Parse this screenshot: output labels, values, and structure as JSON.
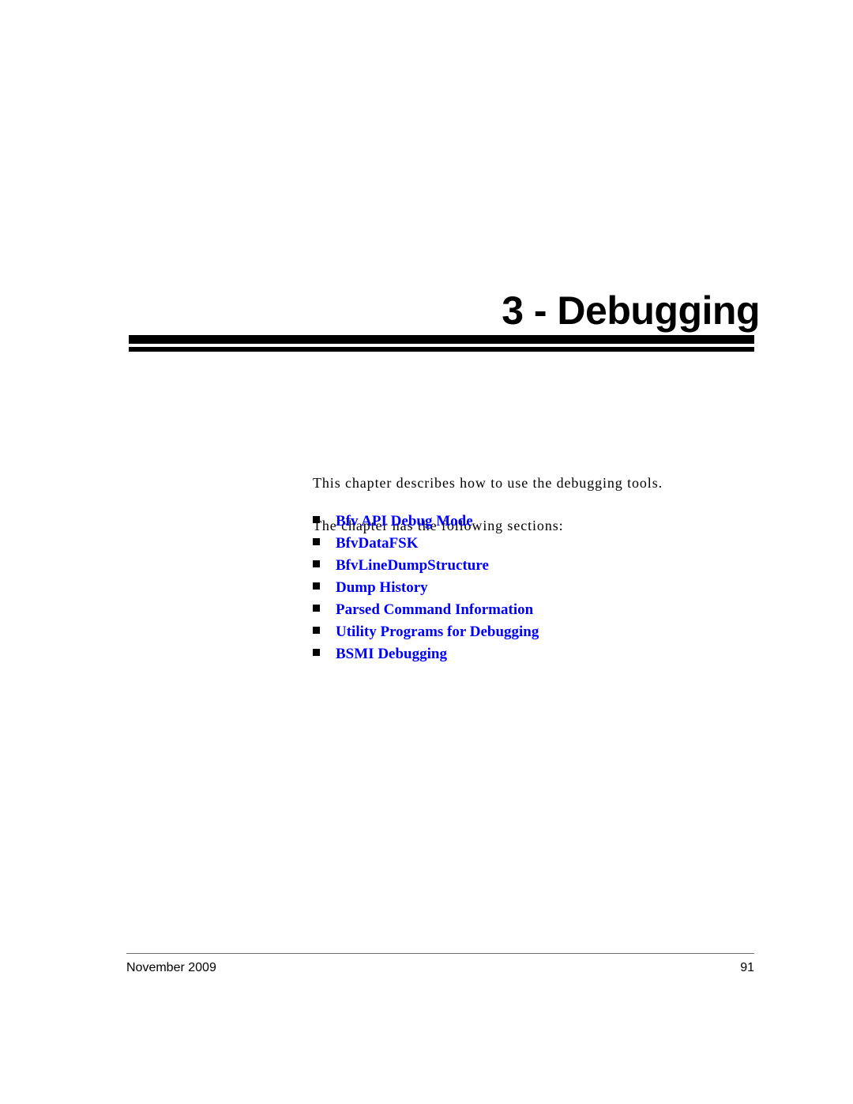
{
  "document": {
    "chapter_title": "3 - Debugging"
  },
  "body": {
    "paragraphs": [
      "This chapter describes how to use the debugging tools.",
      "The chapter has the following sections:"
    ]
  },
  "sections": {
    "bullet_glyph": "square-bullet",
    "link_color": "#0000ff",
    "items": [
      {
        "label": "Bfv API Debug Mode"
      },
      {
        "label": "BfvDataFSK"
      },
      {
        "label": "BfvLineDumpStructure"
      },
      {
        "label": "Dump History"
      },
      {
        "label": "Parsed Command Information"
      },
      {
        "label": "Utility Programs for Debugging"
      },
      {
        "label": "BSMI Debugging"
      }
    ]
  },
  "footer": {
    "date": "November 2009",
    "page_number": "91"
  }
}
